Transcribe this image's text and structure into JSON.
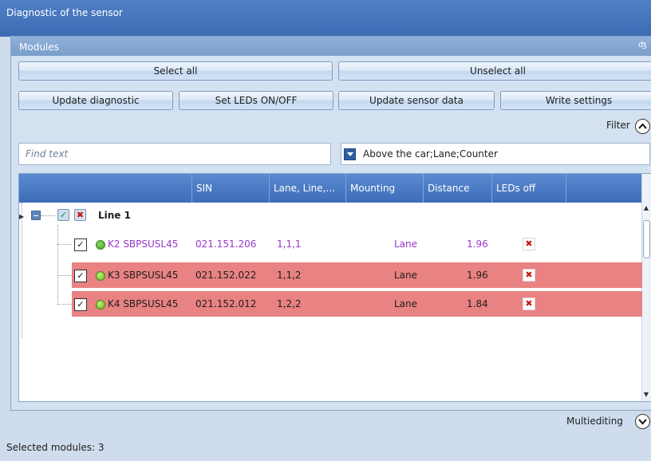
{
  "window": {
    "title": "Diagnostic of the sensor"
  },
  "panel": {
    "title": "Modules",
    "pin_icon": "pin-icon"
  },
  "buttons": {
    "select_all": "Select all",
    "unselect_all": "Unselect all",
    "update_diagnostic": "Update diagnostic",
    "set_leds": "Set LEDs ON/OFF",
    "update_sensor_data": "Update sensor data",
    "write_settings": "Write settings"
  },
  "filter": {
    "label": "Filter",
    "toggle_glyph": "^",
    "search_placeholder": "Find text",
    "dropdown_value": "Above the car;Lane;Counter"
  },
  "grid": {
    "columns": [
      "",
      "SIN",
      "Lane, Line,...",
      "Mounting",
      "Distance",
      "LEDs off",
      ""
    ],
    "group": {
      "label": "Line 1",
      "checked": true,
      "has_error": true
    },
    "rows": [
      {
        "checked": true,
        "name": "K2 SBPSUSL45",
        "sin": "021.151.206",
        "lane_line": "1,1,1",
        "mounting": "Lane",
        "distance": "1.96",
        "leds_off": true,
        "alert": false,
        "text_color": "#9a37c9"
      },
      {
        "checked": true,
        "name": "K3 SBPSUSL45",
        "sin": "021.152.022",
        "lane_line": "1,1,2",
        "mounting": "Lane",
        "distance": "1.96",
        "leds_off": true,
        "alert": true,
        "text_color": "#1e1e1e"
      },
      {
        "checked": true,
        "name": "K4 SBPSUSL45",
        "sin": "021.152.012",
        "lane_line": "1,2,2",
        "mounting": "Lane",
        "distance": "1.84",
        "leds_off": true,
        "alert": true,
        "text_color": "#1e1e1e"
      }
    ]
  },
  "footer": {
    "multiediting_label": "Multiediting",
    "multiediting_glyph": "v",
    "status": "Selected modules: 3"
  },
  "colors": {
    "accent": "#3d6db8",
    "alert_row": "#e98282",
    "purple_text": "#9a37c9"
  }
}
